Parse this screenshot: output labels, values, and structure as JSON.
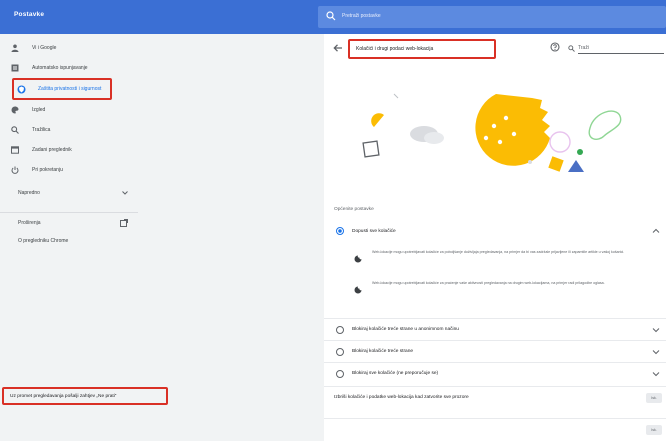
{
  "topbar": {
    "title": "Postavke",
    "search_placeholder": "Pretraži postavke"
  },
  "sidebar": {
    "items": [
      {
        "label": "Vi i Google",
        "icon": "person-icon"
      },
      {
        "label": "Automatsko ispunjavanje",
        "icon": "clipboard-icon"
      },
      {
        "label": "Zaštita privatnosti i sigurnost",
        "icon": "shield-icon",
        "active": true
      },
      {
        "label": "Izgled",
        "icon": "palette-icon"
      },
      {
        "label": "Tražilica",
        "icon": "search-icon"
      },
      {
        "label": "Zadani preglednik",
        "icon": "browser-icon"
      },
      {
        "label": "Pri pokretanju",
        "icon": "power-icon"
      }
    ],
    "advanced_label": "Napredno",
    "extensions_label": "Proširenja",
    "about_label": "O pregledniku Chrome"
  },
  "main": {
    "header_title": "Kolačići i drugi podaci web-lokacija",
    "search_value": "Traži",
    "section_label": "Općenite postavke",
    "options": [
      {
        "label": "Dopusti sve kolačiće",
        "selected": true
      },
      {
        "label": "Blokiraj kolačiće treće strane u anonimnom načinu",
        "selected": false
      },
      {
        "label": "Blokiraj kolačiće treće strane",
        "selected": false
      },
      {
        "label": "Blokiraj sve kolačiće (ne preporučuje se)",
        "selected": false
      }
    ],
    "sub_items": [
      "Web-lokacije mogu upotrebljavati kolačiće za poboljšanje doživljaja pregledavanja, na primjer da bi vas zadržale prijavljene ili zapamtile artikle u vašoj košarici.",
      "Web-lokacije mogu upotrebljavati kolačiće za praćenje vaše aktivnosti pregledavanja na drugim web-lokacijama, na primjer radi prilagodbe oglasa."
    ],
    "clear_on_exit_label": "Izbriši kolačiće i podatke web-lokacija kad zatvorite sve prozore",
    "dnt_label": "Uz promet pregledavanja pošalji zahtjev „Ne prati”",
    "toggle_text": "Isk."
  },
  "colors": {
    "accent": "#1a73e8",
    "topbar": "#3b6fd4",
    "highlight": "#d93025"
  }
}
